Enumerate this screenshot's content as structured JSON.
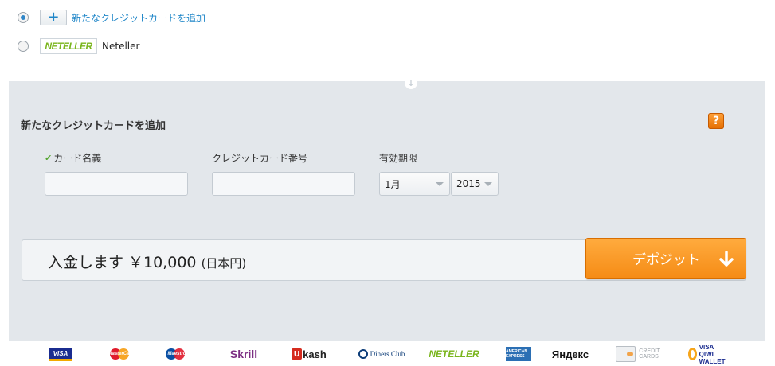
{
  "payment_options": [
    {
      "label": "新たなクレジットカードを追加",
      "selected": true,
      "icon": "plus-icon"
    },
    {
      "label": "Neteller",
      "selected": false,
      "icon": "neteller-logo",
      "logo_text": "NETELLER"
    }
  ],
  "form": {
    "title": "新たなクレジットカードを追加",
    "help_icon_text": "?",
    "card_name_label": "カード名義",
    "card_number_label": "クレジットカード番号",
    "expiry_label": "有効期限",
    "card_name_value": "",
    "card_number_value": "",
    "expiry_month": "1月",
    "expiry_year": "2015"
  },
  "deposit": {
    "amount_text": "入金します ￥10,000",
    "currency_text": "(日本円)",
    "button_label": "デポジット"
  },
  "payment_logos": {
    "visa": "VISA",
    "mastercard": "MasterCard",
    "maestro": "Maestro",
    "skrill": "Skrill",
    "ukash_u": "U",
    "ukash": "kash",
    "diners": "Diners Club",
    "neteller": "NETELLER",
    "amex": "AMERICAN EXPRESS",
    "yandex": "Яндекс",
    "credit_cards": "CREDIT CARDS",
    "qiwi": "VISA QIWI WALLET"
  },
  "colors": {
    "accent_blue": "#1f86c8",
    "panel_bg": "#e3e7eb",
    "deposit_orange": "#f58b15"
  }
}
